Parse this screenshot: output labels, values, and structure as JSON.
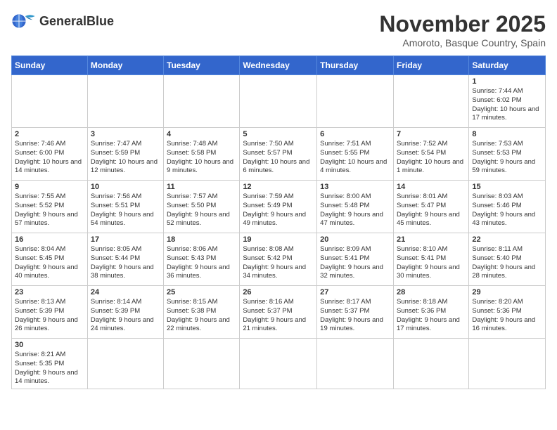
{
  "header": {
    "logo_text_normal": "General",
    "logo_text_bold": "Blue",
    "month_title": "November 2025",
    "location": "Amoroto, Basque Country, Spain"
  },
  "weekdays": [
    "Sunday",
    "Monday",
    "Tuesday",
    "Wednesday",
    "Thursday",
    "Friday",
    "Saturday"
  ],
  "weeks": [
    [
      {
        "day": "",
        "info": ""
      },
      {
        "day": "",
        "info": ""
      },
      {
        "day": "",
        "info": ""
      },
      {
        "day": "",
        "info": ""
      },
      {
        "day": "",
        "info": ""
      },
      {
        "day": "",
        "info": ""
      },
      {
        "day": "1",
        "info": "Sunrise: 7:44 AM\nSunset: 6:02 PM\nDaylight: 10 hours\nand 17 minutes."
      }
    ],
    [
      {
        "day": "2",
        "info": "Sunrise: 7:46 AM\nSunset: 6:00 PM\nDaylight: 10 hours\nand 14 minutes."
      },
      {
        "day": "3",
        "info": "Sunrise: 7:47 AM\nSunset: 5:59 PM\nDaylight: 10 hours\nand 12 minutes."
      },
      {
        "day": "4",
        "info": "Sunrise: 7:48 AM\nSunset: 5:58 PM\nDaylight: 10 hours\nand 9 minutes."
      },
      {
        "day": "5",
        "info": "Sunrise: 7:50 AM\nSunset: 5:57 PM\nDaylight: 10 hours\nand 6 minutes."
      },
      {
        "day": "6",
        "info": "Sunrise: 7:51 AM\nSunset: 5:55 PM\nDaylight: 10 hours\nand 4 minutes."
      },
      {
        "day": "7",
        "info": "Sunrise: 7:52 AM\nSunset: 5:54 PM\nDaylight: 10 hours\nand 1 minute."
      },
      {
        "day": "8",
        "info": "Sunrise: 7:53 AM\nSunset: 5:53 PM\nDaylight: 9 hours\nand 59 minutes."
      }
    ],
    [
      {
        "day": "9",
        "info": "Sunrise: 7:55 AM\nSunset: 5:52 PM\nDaylight: 9 hours\nand 57 minutes."
      },
      {
        "day": "10",
        "info": "Sunrise: 7:56 AM\nSunset: 5:51 PM\nDaylight: 9 hours\nand 54 minutes."
      },
      {
        "day": "11",
        "info": "Sunrise: 7:57 AM\nSunset: 5:50 PM\nDaylight: 9 hours\nand 52 minutes."
      },
      {
        "day": "12",
        "info": "Sunrise: 7:59 AM\nSunset: 5:49 PM\nDaylight: 9 hours\nand 49 minutes."
      },
      {
        "day": "13",
        "info": "Sunrise: 8:00 AM\nSunset: 5:48 PM\nDaylight: 9 hours\nand 47 minutes."
      },
      {
        "day": "14",
        "info": "Sunrise: 8:01 AM\nSunset: 5:47 PM\nDaylight: 9 hours\nand 45 minutes."
      },
      {
        "day": "15",
        "info": "Sunrise: 8:03 AM\nSunset: 5:46 PM\nDaylight: 9 hours\nand 43 minutes."
      }
    ],
    [
      {
        "day": "16",
        "info": "Sunrise: 8:04 AM\nSunset: 5:45 PM\nDaylight: 9 hours\nand 40 minutes."
      },
      {
        "day": "17",
        "info": "Sunrise: 8:05 AM\nSunset: 5:44 PM\nDaylight: 9 hours\nand 38 minutes."
      },
      {
        "day": "18",
        "info": "Sunrise: 8:06 AM\nSunset: 5:43 PM\nDaylight: 9 hours\nand 36 minutes."
      },
      {
        "day": "19",
        "info": "Sunrise: 8:08 AM\nSunset: 5:42 PM\nDaylight: 9 hours\nand 34 minutes."
      },
      {
        "day": "20",
        "info": "Sunrise: 8:09 AM\nSunset: 5:41 PM\nDaylight: 9 hours\nand 32 minutes."
      },
      {
        "day": "21",
        "info": "Sunrise: 8:10 AM\nSunset: 5:41 PM\nDaylight: 9 hours\nand 30 minutes."
      },
      {
        "day": "22",
        "info": "Sunrise: 8:11 AM\nSunset: 5:40 PM\nDaylight: 9 hours\nand 28 minutes."
      }
    ],
    [
      {
        "day": "23",
        "info": "Sunrise: 8:13 AM\nSunset: 5:39 PM\nDaylight: 9 hours\nand 26 minutes."
      },
      {
        "day": "24",
        "info": "Sunrise: 8:14 AM\nSunset: 5:39 PM\nDaylight: 9 hours\nand 24 minutes."
      },
      {
        "day": "25",
        "info": "Sunrise: 8:15 AM\nSunset: 5:38 PM\nDaylight: 9 hours\nand 22 minutes."
      },
      {
        "day": "26",
        "info": "Sunrise: 8:16 AM\nSunset: 5:37 PM\nDaylight: 9 hours\nand 21 minutes."
      },
      {
        "day": "27",
        "info": "Sunrise: 8:17 AM\nSunset: 5:37 PM\nDaylight: 9 hours\nand 19 minutes."
      },
      {
        "day": "28",
        "info": "Sunrise: 8:18 AM\nSunset: 5:36 PM\nDaylight: 9 hours\nand 17 minutes."
      },
      {
        "day": "29",
        "info": "Sunrise: 8:20 AM\nSunset: 5:36 PM\nDaylight: 9 hours\nand 16 minutes."
      }
    ],
    [
      {
        "day": "30",
        "info": "Sunrise: 8:21 AM\nSunset: 5:35 PM\nDaylight: 9 hours\nand 14 minutes."
      },
      {
        "day": "",
        "info": ""
      },
      {
        "day": "",
        "info": ""
      },
      {
        "day": "",
        "info": ""
      },
      {
        "day": "",
        "info": ""
      },
      {
        "day": "",
        "info": ""
      },
      {
        "day": "",
        "info": ""
      }
    ]
  ]
}
